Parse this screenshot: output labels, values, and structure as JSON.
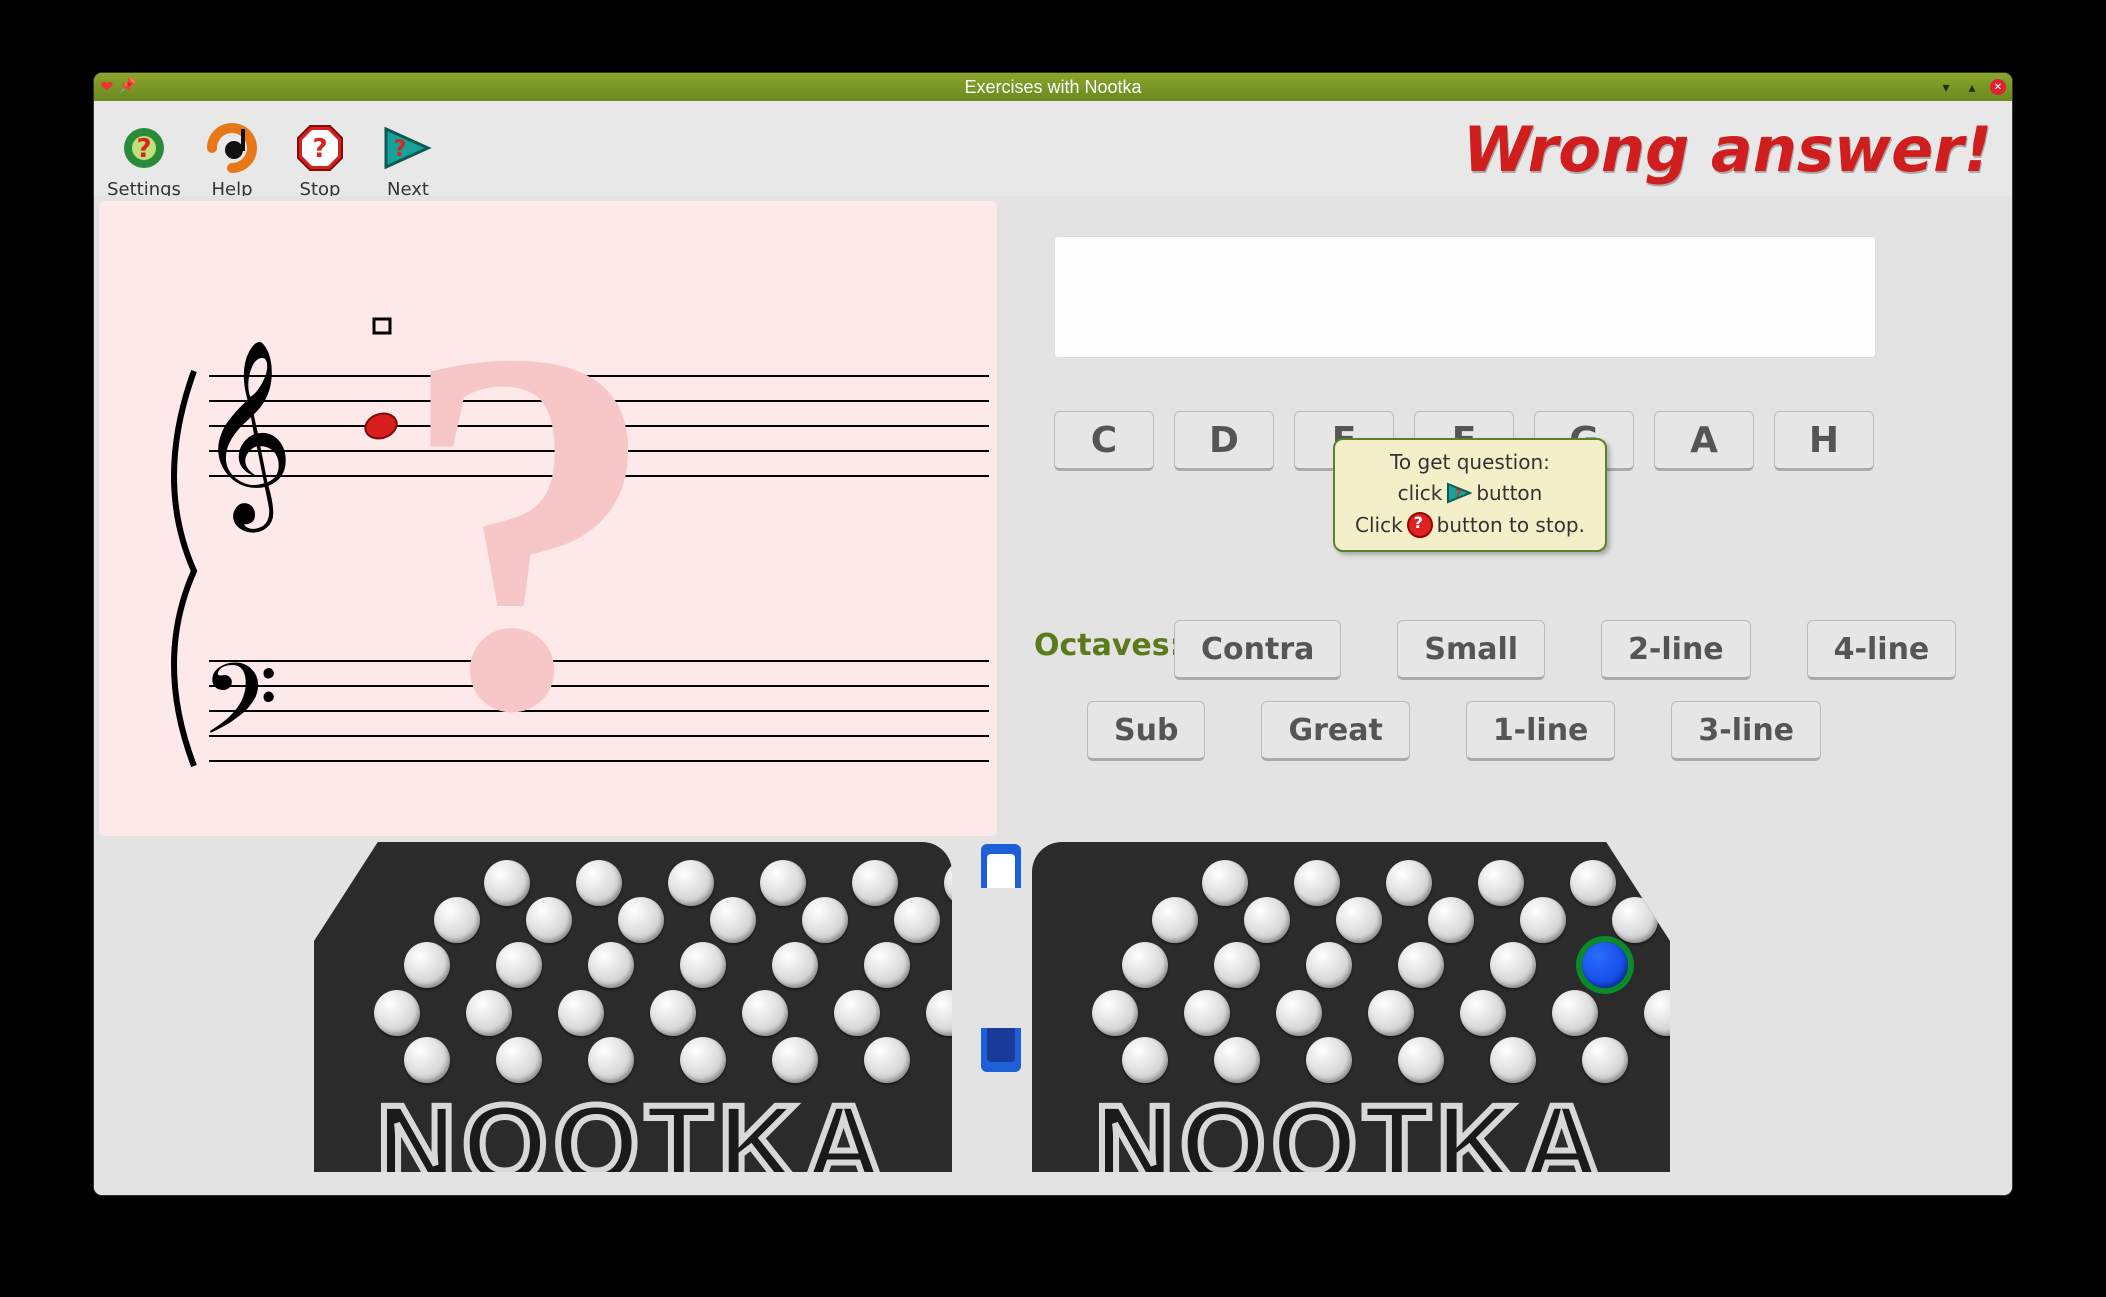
{
  "window_title": "Exercises with Nootka",
  "toolbar": {
    "settings": "Settings",
    "help": "Help",
    "stop": "Stop",
    "next": "Next"
  },
  "status_text": "Wrong answer!",
  "note_buttons": [
    "C",
    "D",
    "E",
    "F",
    "G",
    "A",
    "H"
  ],
  "octaves_label": "Octaves:",
  "octave_buttons_row1": [
    "Contra",
    "Small",
    "2-line",
    "4-line"
  ],
  "octave_buttons_row2": [
    "Sub",
    "Great",
    "1-line",
    "3-line"
  ],
  "tooltip": {
    "line1": "To get question:",
    "line2_pre": "click",
    "line2_post": "button",
    "line3_pre": "Click",
    "line3_post": "button to stop."
  },
  "bandoneon_logo": "NOOTKA",
  "score": {
    "clefs": [
      "treble",
      "bass"
    ],
    "question_note": {
      "staff": "treble",
      "line": 2,
      "color": "red"
    }
  },
  "selected_bandoneon_button": {
    "side": "right",
    "index": 18
  }
}
